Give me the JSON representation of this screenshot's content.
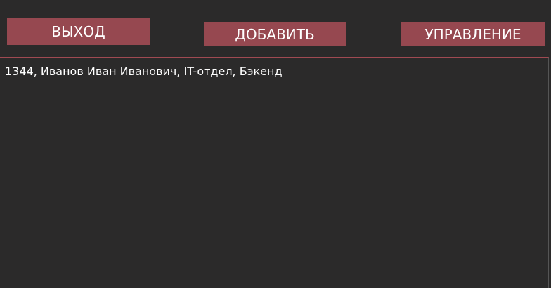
{
  "toolbar": {
    "exit_label": "ВЫХОД",
    "add_label": "ДОБАВИТЬ",
    "manage_label": "УПРАВЛЕНИЕ"
  },
  "list": {
    "items": [
      {
        "text": "1344, Иванов Иван Иванович, IT-отдел, Бэкенд"
      }
    ]
  },
  "colors": {
    "background": "#2b2a2a",
    "button": "#964850",
    "separator": "#a04a52",
    "text": "#ffffff"
  }
}
